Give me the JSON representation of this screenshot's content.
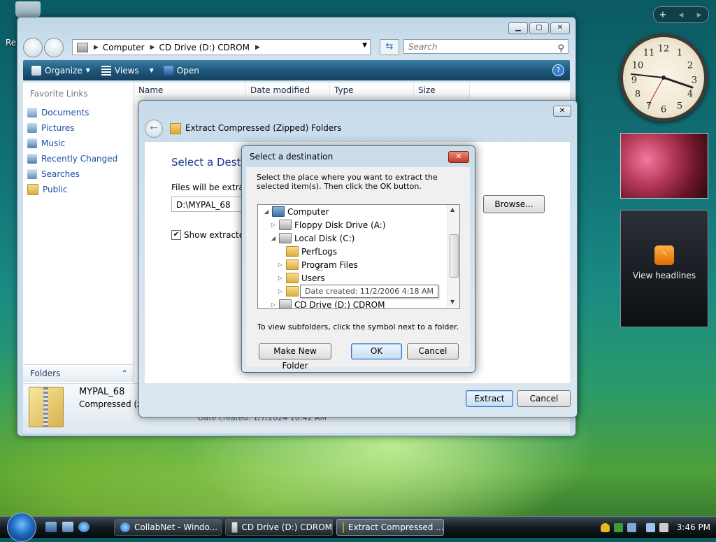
{
  "desktop": {
    "partial_label": "Re"
  },
  "explorer": {
    "address": [
      "Computer",
      "CD Drive (D:) CDROM"
    ],
    "search_placeholder": "Search",
    "toolbar": {
      "organize": "Organize",
      "views": "Views",
      "open": "Open"
    },
    "favorite_links_header": "Favorite Links",
    "favorite_links": [
      "Documents",
      "Pictures",
      "Music",
      "Recently Changed",
      "Searches",
      "Public"
    ],
    "folders_label": "Folders",
    "columns": [
      "Name",
      "Date modified",
      "Type",
      "Size"
    ],
    "details": {
      "name": "MYPAL_68",
      "type": "Compressed (zip",
      "date": "Date created: 1/7/2024 10:42 AM"
    }
  },
  "wizard": {
    "title": "Extract Compressed (Zipped) Folders",
    "heading": "Select a Destin",
    "files_label": "Files will be extracte",
    "path_value": "D:\\MYPAL_68",
    "browse": "Browse...",
    "show_label": "Show extracted f",
    "extract": "Extract",
    "cancel": "Cancel"
  },
  "dest_dialog": {
    "title": "Select a destination",
    "description": "Select the place where you want to extract the selected item(s).  Then click the OK button.",
    "tree": [
      {
        "label": "Computer"
      },
      {
        "label": "Floppy Disk Drive (A:)"
      },
      {
        "label": "Local Disk (C:)"
      },
      {
        "label": "PerfLogs"
      },
      {
        "label": "Program Files"
      },
      {
        "label": "Users"
      },
      {
        "label": ""
      },
      {
        "label": "CD Drive (D:) CDROM"
      }
    ],
    "tooltip": "Date created: 11/2/2006 4:18 AM",
    "hint": "To view subfolders, click the symbol next to a folder.",
    "make_new_folder": "Make New Folder",
    "ok": "OK",
    "cancel": "Cancel"
  },
  "gadgets": {
    "clock_numbers": [
      "12",
      "1",
      "2",
      "3",
      "4",
      "5",
      "6",
      "7",
      "8",
      "9",
      "10",
      "11"
    ],
    "feed_label": "View headlines"
  },
  "taskbar": {
    "tasks": [
      "CollabNet - Windo...",
      "CD Drive (D:) CDROM",
      "Extract Compressed ..."
    ],
    "clock": "3:46 PM"
  }
}
